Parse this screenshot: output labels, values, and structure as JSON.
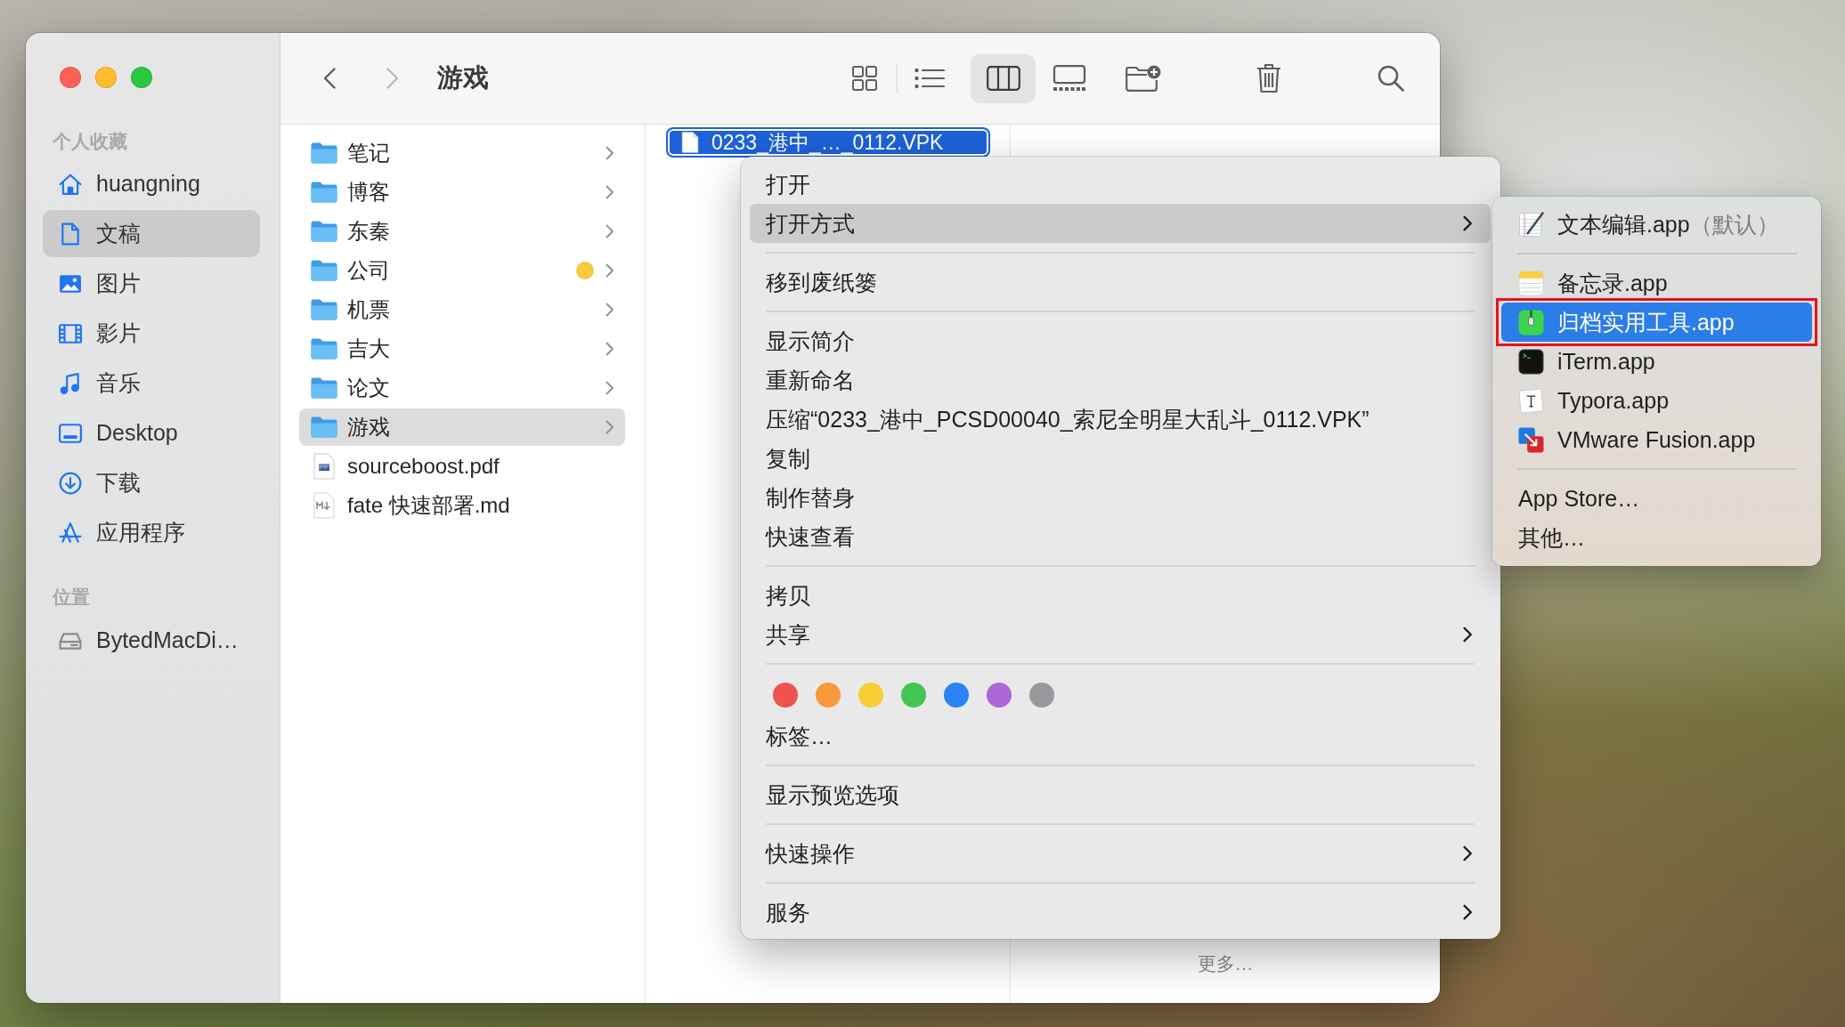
{
  "window": {
    "title": "游戏",
    "controls": [
      {
        "kind": "close"
      },
      {
        "kind": "minimize"
      },
      {
        "kind": "zoom"
      }
    ]
  },
  "toolbar": {
    "nav": [
      {
        "kind": "back",
        "disabled": false
      },
      {
        "kind": "forward",
        "disabled": true
      }
    ],
    "view_modes": [
      {
        "kind": "icons",
        "selected": false
      },
      {
        "kind": "list",
        "selected": false
      },
      {
        "kind": "columns",
        "selected": true
      },
      {
        "kind": "gallery",
        "selected": false
      }
    ],
    "actions": [
      {
        "kind": "new_folder"
      },
      {
        "kind": "trash"
      },
      {
        "kind": "search"
      }
    ]
  },
  "sidebar": {
    "sections": [
      {
        "heading": "个人收藏",
        "items": [
          {
            "kind": "home",
            "label": "huangning",
            "selected": false
          },
          {
            "kind": "documents",
            "label": "文稿",
            "selected": true
          },
          {
            "kind": "pictures",
            "label": "图片",
            "selected": false
          },
          {
            "kind": "movies",
            "label": "影片",
            "selected": false
          },
          {
            "kind": "music",
            "label": "音乐",
            "selected": false
          },
          {
            "kind": "desktop",
            "label": "Desktop",
            "selected": false
          },
          {
            "kind": "downloads",
            "label": "下载",
            "selected": false
          },
          {
            "kind": "applications",
            "label": "应用程序",
            "selected": false
          }
        ]
      },
      {
        "heading": "位置",
        "items": [
          {
            "kind": "drive",
            "label": "BytedMacDi…",
            "selected": false
          }
        ]
      }
    ]
  },
  "columns": [
    {
      "items": [
        {
          "kind": "folder",
          "name": "笔记",
          "selected": false
        },
        {
          "kind": "folder",
          "name": "博客",
          "selected": false
        },
        {
          "kind": "folder",
          "name": "东秦",
          "selected": false
        },
        {
          "kind": "folder",
          "name": "公司",
          "selected": false,
          "color": "#f8ca3c"
        },
        {
          "kind": "folder",
          "name": "机票",
          "selected": false
        },
        {
          "kind": "folder",
          "name": "吉大",
          "selected": false
        },
        {
          "kind": "folder",
          "name": "论文",
          "selected": false
        },
        {
          "kind": "folder",
          "name": "游戏",
          "selected": true
        },
        {
          "kind": "pdf",
          "name": "sourceboost.pdf",
          "selected": false
        },
        {
          "kind": "markdown",
          "name": "fate 快速部署.md",
          "selected": false
        }
      ]
    },
    {
      "items": [
        {
          "kind": "document",
          "name": "0233_港中_…_0112.VPK",
          "selected": true
        }
      ]
    }
  ],
  "preview": {
    "more_link": "更多…"
  },
  "context_menu": {
    "groups": [
      {
        "items": [
          {
            "kind": "item",
            "label": "打开",
            "selected": false,
            "submenu": false
          },
          {
            "kind": "item",
            "label": "打开方式",
            "selected": true,
            "submenu": true
          }
        ]
      },
      {
        "items": [
          {
            "kind": "item",
            "label": "移到废纸篓",
            "selected": false,
            "submenu": false
          }
        ]
      },
      {
        "items": [
          {
            "kind": "item",
            "label": "显示简介",
            "selected": false,
            "submenu": false
          },
          {
            "kind": "item",
            "label": "重新命名",
            "selected": false,
            "submenu": false
          },
          {
            "kind": "item",
            "label": "压缩“0233_港中_PCSD00040_索尼全明星大乱斗_0112.VPK”",
            "selected": false,
            "submenu": false
          },
          {
            "kind": "item",
            "label": "复制",
            "selected": false,
            "submenu": false
          },
          {
            "kind": "item",
            "label": "制作替身",
            "selected": false,
            "submenu": false
          },
          {
            "kind": "item",
            "label": "快速查看",
            "selected": false,
            "submenu": false
          }
        ]
      },
      {
        "items": [
          {
            "kind": "item",
            "label": "拷贝",
            "selected": false,
            "submenu": false
          },
          {
            "kind": "item",
            "label": "共享",
            "selected": false,
            "submenu": true
          }
        ]
      },
      {
        "items": [
          {
            "kind": "tags",
            "tags": [
              {
                "color": "#f0524f"
              },
              {
                "color": "#f6993a"
              },
              {
                "color": "#f7cd35"
              },
              {
                "color": "#43c555"
              },
              {
                "color": "#2c82f6"
              },
              {
                "color": "#ad66d5"
              },
              {
                "color": "#98989d"
              }
            ]
          },
          {
            "kind": "item",
            "label": "标签…",
            "selected": false,
            "submenu": false
          }
        ]
      },
      {
        "items": [
          {
            "kind": "item",
            "label": "显示预览选项",
            "selected": false,
            "submenu": false
          }
        ]
      },
      {
        "items": [
          {
            "kind": "item",
            "label": "快速操作",
            "selected": false,
            "submenu": true
          }
        ]
      },
      {
        "items": [
          {
            "kind": "item",
            "label": "服务",
            "selected": false,
            "submenu": true
          }
        ]
      }
    ]
  },
  "open_with_menu": {
    "groups": [
      {
        "items": [
          {
            "kind": "textedit",
            "name": "文本编辑.app",
            "note": "（默认）",
            "selected": false,
            "annotated": false
          }
        ]
      },
      {
        "items": [
          {
            "kind": "notes",
            "name": "备忘录.app",
            "selected": false,
            "annotated": false
          },
          {
            "kind": "archive",
            "name": "归档实用工具.app",
            "selected": true,
            "annotated": true
          },
          {
            "kind": "terminal",
            "name": "iTerm.app",
            "selected": false,
            "annotated": false
          },
          {
            "kind": "typora",
            "name": "Typora.app",
            "selected": false,
            "annotated": false
          },
          {
            "kind": "vmware",
            "name": "VMware Fusion.app",
            "selected": false,
            "annotated": false
          }
        ]
      },
      {
        "items": [
          {
            "kind": "plain",
            "name": "App Store…",
            "selected": false,
            "annotated": false
          },
          {
            "kind": "plain",
            "name": "其他…",
            "selected": false,
            "annotated": false
          }
        ]
      }
    ]
  }
}
